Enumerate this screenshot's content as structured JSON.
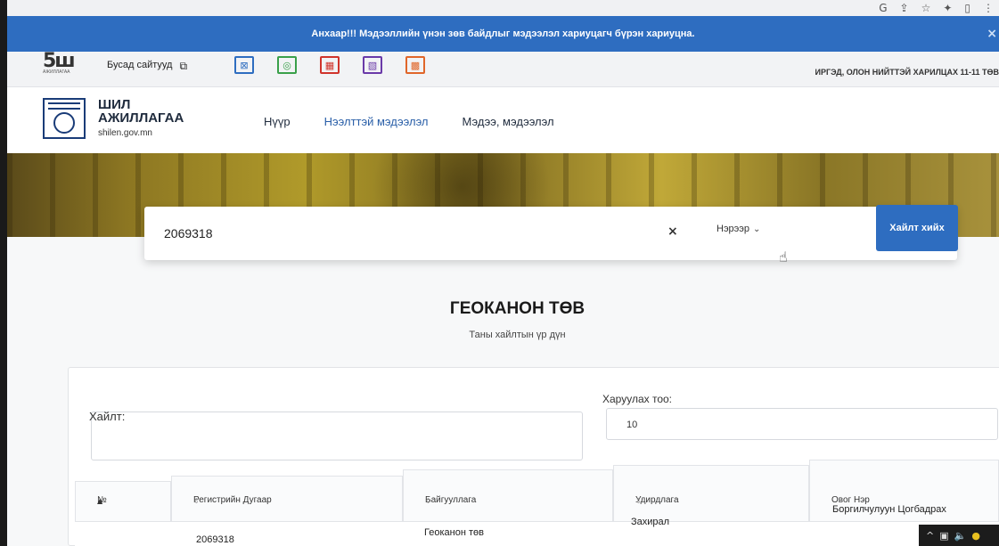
{
  "alert": {
    "text": "Анхаар!!! Мэдээллийн үнэн зөв байдлыг мэдээлэл хариуцагч бүрэн хариуцна.",
    "close_icon": "close-icon"
  },
  "topbar": {
    "logo_text": "5ш",
    "logo_caption": "АЖИЛЛАГАА",
    "other_sites": "Бусад сайтууд",
    "right_text": "ИРГЭД, ОЛОН НИЙТТЭЙ ХАРИЛЦАХ 11-11 ТӨВ",
    "quick_icons": [
      {
        "name": "quick-icon-1",
        "color": "#2e6dc0",
        "glyph": "⊠"
      },
      {
        "name": "quick-icon-2",
        "color": "#3aa04a",
        "glyph": "◎"
      },
      {
        "name": "quick-icon-3",
        "color": "#d0342c",
        "glyph": "▦"
      },
      {
        "name": "quick-icon-4",
        "color": "#6a3aa8",
        "glyph": "▧"
      },
      {
        "name": "quick-icon-5",
        "color": "#e0662a",
        "glyph": "▩"
      }
    ]
  },
  "brand": {
    "line1": "ШИЛ",
    "line2": "АЖИЛЛАГАА",
    "domain": "shilen.gov.mn"
  },
  "nav": {
    "items": [
      {
        "label": "Нүүр"
      },
      {
        "label": "Нээлттэй мэдээлэл"
      },
      {
        "label": "Мэдээ, мэдээлэл"
      }
    ]
  },
  "search": {
    "value": "2069318",
    "clear": "×",
    "mode": "Нэрээр",
    "button": "Хайлт хийх"
  },
  "org": {
    "title": "ГЕОКАНОН ТӨВ",
    "subtitle": "Таны хайлтын үр дүн"
  },
  "filters": {
    "search_label": "Хайлт:",
    "count_label": "Харуулах тоо:",
    "count_value": "10"
  },
  "table": {
    "columns": [
      "№",
      "Регистрийн Дугаар",
      "Байгууллага",
      "Удирдлага",
      "Овог Нэр"
    ],
    "rows": [
      {
        "reg": "2069318",
        "org": "Геоканон төв",
        "role": "Захирал",
        "name": "Боргилчулуун Цогбадрах"
      }
    ]
  },
  "colors": {
    "accent": "#2e6dc0",
    "brand": "#1a3c78"
  }
}
